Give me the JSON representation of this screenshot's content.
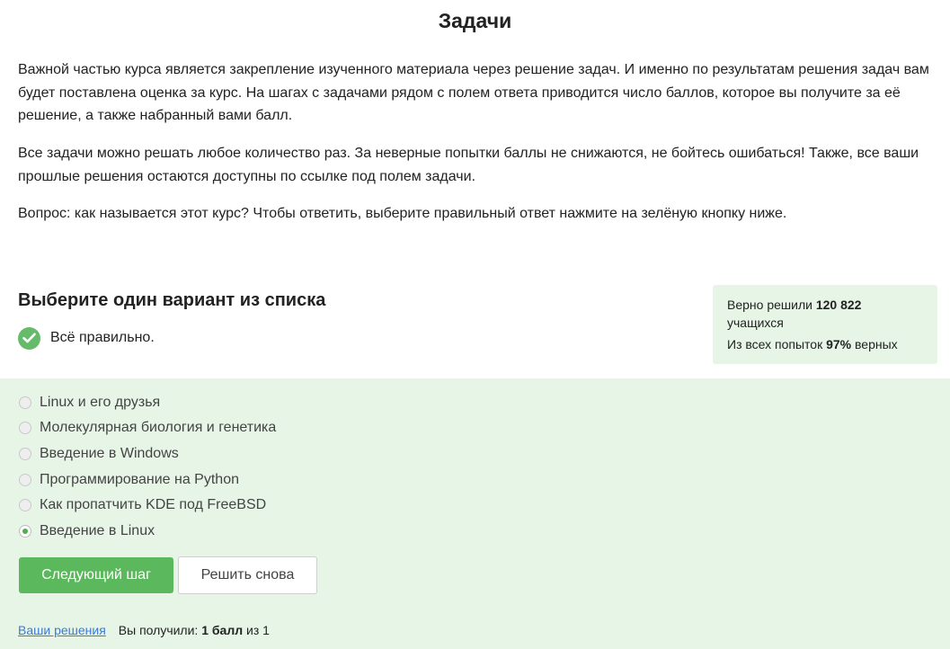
{
  "page": {
    "title": "Задачи"
  },
  "intro": {
    "p1": "Важной частью курса является закрепление изученного материала через решение задач. И именно по результатам решения задач вам будет поставлена оценка за курс. На шагах с задачами рядом с полем ответа приводится число баллов, которое вы получите за её решение, а также набранный вами балл.",
    "p2": "Все задачи можно решать любое количество раз. За неверные попытки баллы не снижаются, не бойтесь ошибаться! Также, все ваши прошлые решения остаются доступны по ссылке под полем задачи.",
    "p3": "Вопрос: как называется этот курс? Чтобы ответить, выберите правильный ответ нажмите на зелёную кнопку ниже."
  },
  "quiz": {
    "title": "Выберите один вариант из списка",
    "status_icon": "check-icon",
    "status_text": "Всё правильно.",
    "options": [
      {
        "label": "Linux и его друзья",
        "selected": false
      },
      {
        "label": "Молекулярная биология и генетика",
        "selected": false
      },
      {
        "label": "Введение в Windows",
        "selected": false
      },
      {
        "label": "Программирование на Python",
        "selected": false
      },
      {
        "label": "Как пропатчить KDE под FreeBSD",
        "selected": false
      },
      {
        "label": "Введение в Linux",
        "selected": true
      }
    ],
    "next_button": "Следующий шаг",
    "retry_button": "Решить снова"
  },
  "stats": {
    "solved_prefix": "Верно решили",
    "solved_count": "120 822",
    "solved_suffix": "учащихся",
    "attempts_prefix": "Из всех попыток",
    "attempts_percent": "97%",
    "attempts_suffix": "верных"
  },
  "footer": {
    "solutions_link": "Ваши решения",
    "score_prefix": "Вы получили:",
    "score_value": "1 балл",
    "score_suffix": "из 1"
  },
  "colors": {
    "accent_green": "#5cb85c",
    "check_green": "#66bb6a",
    "panel_bg": "#e7f5e6",
    "link": "#3a7bd5"
  }
}
